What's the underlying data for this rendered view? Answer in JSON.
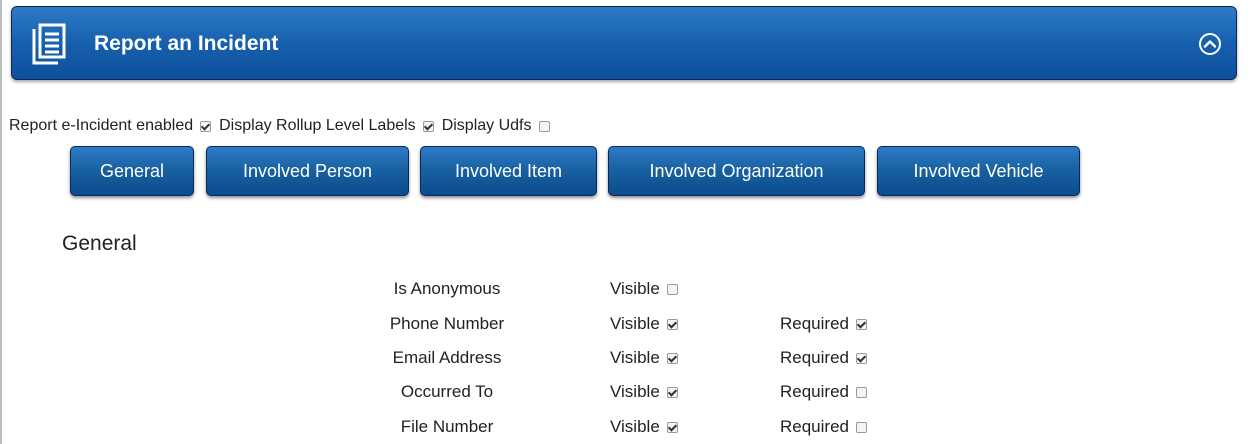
{
  "header": {
    "title": "Report an Incident",
    "icon": "documents-icon",
    "collapse_icon": "chevron-up-circle-icon",
    "color": "#1862b0"
  },
  "options": [
    {
      "label": "Report e-Incident enabled",
      "checked": true
    },
    {
      "label": "Display Rollup Level Labels",
      "checked": true
    },
    {
      "label": "Display Udfs",
      "checked": false
    }
  ],
  "tabs": [
    {
      "label": "General",
      "active": true
    },
    {
      "label": "Involved Person",
      "active": false
    },
    {
      "label": "Involved Item",
      "active": false
    },
    {
      "label": "Involved Organization",
      "active": false
    },
    {
      "label": "Involved Vehicle",
      "active": false
    }
  ],
  "section": {
    "title": "General"
  },
  "visible_label": "Visible",
  "required_label": "Required",
  "fields": [
    {
      "name": "Is Anonymous",
      "visible": false,
      "required": null
    },
    {
      "name": "Phone Number",
      "visible": true,
      "required": true
    },
    {
      "name": "Email Address",
      "visible": true,
      "required": true
    },
    {
      "name": "Occurred To",
      "visible": true,
      "required": false
    },
    {
      "name": "File Number",
      "visible": true,
      "required": false
    }
  ]
}
